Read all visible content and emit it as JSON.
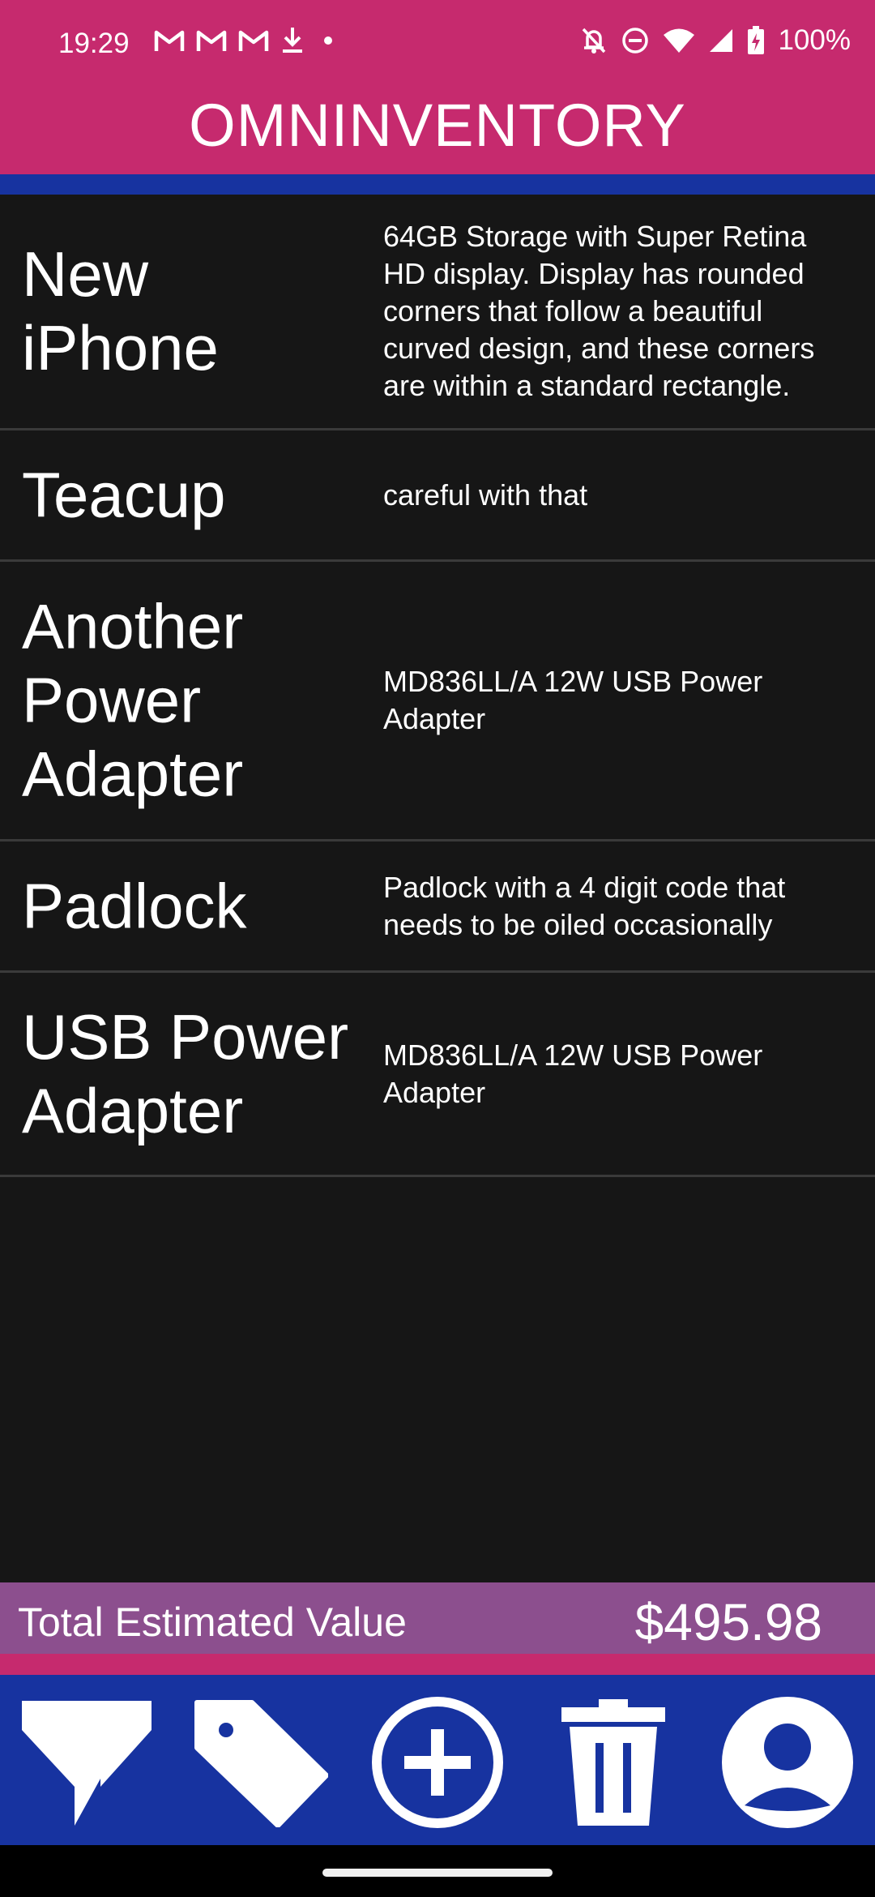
{
  "status_bar": {
    "time": "19:29",
    "notification_icons": [
      "gmail-icon",
      "gmail-icon",
      "gmail-icon",
      "download-icon",
      "dot-icon"
    ],
    "system_icons": [
      "notifications-off-icon",
      "do-not-disturb-icon",
      "wifi-icon",
      "signal-icon",
      "battery-charging-icon"
    ],
    "battery": "100%"
  },
  "header": {
    "title": "OMNINVENTORY",
    "accent_color": "#c62a6e",
    "stripe_color": "#1733a0"
  },
  "items": [
    {
      "name": "New iPhone",
      "description": "64GB Storage with Super Retina HD display. Display has rounded corners that follow a beautiful curved design, and these corners are within a standard rectangle."
    },
    {
      "name": "Teacup",
      "description": "careful with that"
    },
    {
      "name": "Another Power Adapter",
      "description": "MD836LL/A 12W USB Power Adapter"
    },
    {
      "name": "Padlock",
      "description": "Padlock with a 4 digit code that needs to be oiled occasionally"
    },
    {
      "name": "USB Power Adapter",
      "description": "MD836LL/A 12W USB Power Adapter"
    }
  ],
  "total": {
    "label": "Total Estimated Value",
    "value": "$495.98",
    "color": "#8c4f8e"
  },
  "toolbar": {
    "buttons": [
      "filter-icon",
      "tag-icon",
      "add-circle-icon",
      "trash-icon",
      "account-icon"
    ],
    "color": "#1733a0"
  }
}
